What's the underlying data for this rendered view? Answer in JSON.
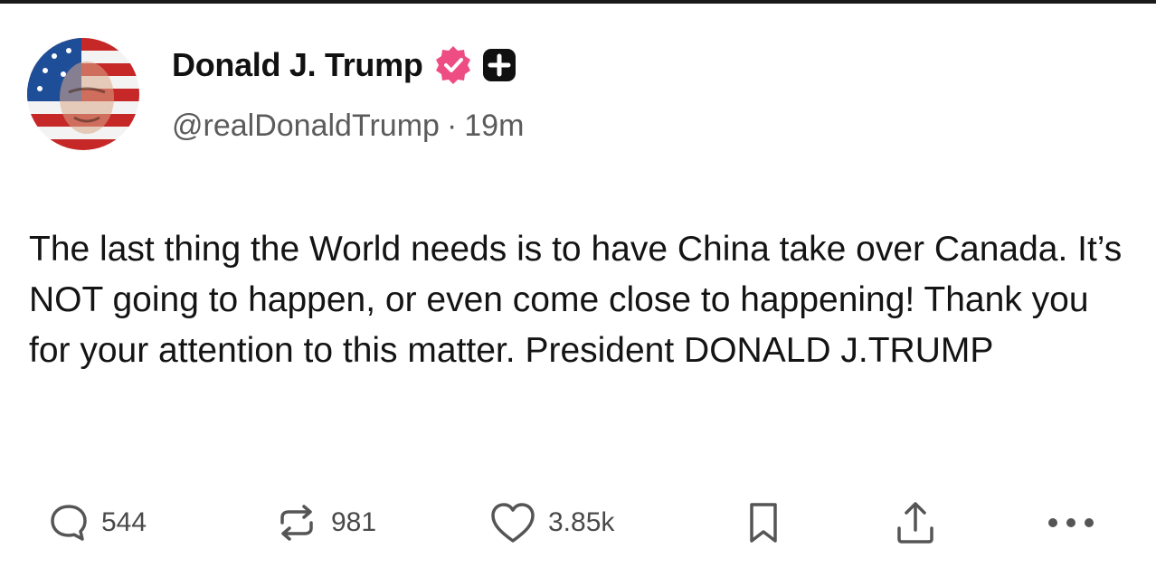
{
  "post": {
    "author_name": "Donald J. Trump",
    "handle": "@realDonaldTrump",
    "separator": "·",
    "time_ago": "19m",
    "text": "The last thing the World needs is to have China take over Canada. It’s NOT going to happen, or even come close to happening! Thank you for your attention to this matter. President DONALD J.TRUMP"
  },
  "icons": {
    "avatar": "avatar-image",
    "verified": "verified-badge-icon",
    "plus": "plus-badge-icon",
    "reply": "comment-icon",
    "repost": "repost-icon",
    "like": "heart-icon",
    "bookmark": "bookmark-icon",
    "share": "share-icon",
    "more": "more-icon"
  },
  "actions": {
    "replies": "544",
    "reposts": "981",
    "likes": "3.85k"
  },
  "colors": {
    "verified": "#ee4d83",
    "text": "#141414",
    "muted": "#5b5b5b",
    "icon": "#555555"
  }
}
